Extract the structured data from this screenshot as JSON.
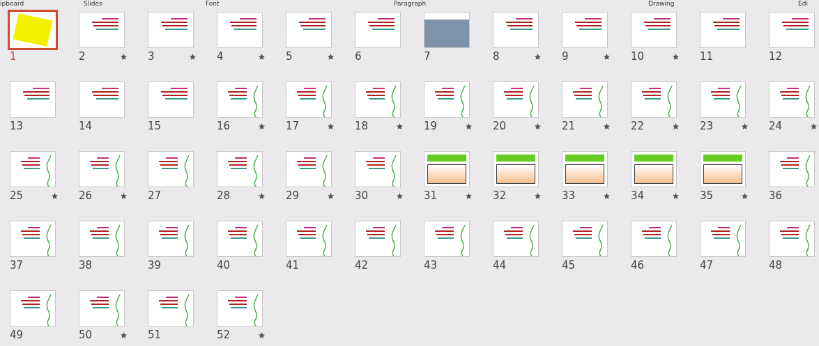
{
  "ribbon_groups": [
    "ipboard",
    "Slides",
    "Font",
    "Paragraph",
    "Drawing",
    "Edi"
  ],
  "slides": [
    {
      "number": "1",
      "kind": "title",
      "starred": false,
      "selected": true
    },
    {
      "number": "2",
      "kind": "text",
      "starred": true,
      "selected": false
    },
    {
      "number": "3",
      "kind": "text",
      "starred": true,
      "selected": false
    },
    {
      "number": "4",
      "kind": "text",
      "starred": true,
      "selected": false
    },
    {
      "number": "5",
      "kind": "text",
      "starred": true,
      "selected": false
    },
    {
      "number": "6",
      "kind": "text",
      "starred": false,
      "selected": false
    },
    {
      "number": "7",
      "kind": "table",
      "starred": false,
      "selected": false
    },
    {
      "number": "8",
      "kind": "text",
      "starred": true,
      "selected": false
    },
    {
      "number": "9",
      "kind": "text",
      "starred": true,
      "selected": false
    },
    {
      "number": "10",
      "kind": "text",
      "starred": true,
      "selected": false
    },
    {
      "number": "11",
      "kind": "text",
      "starred": false,
      "selected": false
    },
    {
      "number": "12",
      "kind": "text",
      "starred": false,
      "selected": false
    },
    {
      "number": "13",
      "kind": "text",
      "starred": false,
      "selected": false
    },
    {
      "number": "14",
      "kind": "text",
      "starred": false,
      "selected": false
    },
    {
      "number": "15",
      "kind": "text",
      "starred": false,
      "selected": false
    },
    {
      "number": "16",
      "kind": "pencil",
      "starred": true,
      "selected": false
    },
    {
      "number": "17",
      "kind": "pencil",
      "starred": true,
      "selected": false
    },
    {
      "number": "18",
      "kind": "pencil",
      "starred": true,
      "selected": false
    },
    {
      "number": "19",
      "kind": "pencil",
      "starred": true,
      "selected": false
    },
    {
      "number": "20",
      "kind": "pencil",
      "starred": true,
      "selected": false
    },
    {
      "number": "21",
      "kind": "pencil",
      "starred": true,
      "selected": false
    },
    {
      "number": "22",
      "kind": "pencil",
      "starred": true,
      "selected": false
    },
    {
      "number": "23",
      "kind": "pencil",
      "starred": true,
      "selected": false
    },
    {
      "number": "24",
      "kind": "pencil",
      "starred": true,
      "selected": false
    },
    {
      "number": "25",
      "kind": "pencil",
      "starred": true,
      "selected": false
    },
    {
      "number": "26",
      "kind": "pencil",
      "starred": true,
      "selected": false
    },
    {
      "number": "27",
      "kind": "pencil",
      "starred": false,
      "selected": false
    },
    {
      "number": "28",
      "kind": "pencil",
      "starred": true,
      "selected": false
    },
    {
      "number": "29",
      "kind": "pencil",
      "starred": true,
      "selected": false
    },
    {
      "number": "30",
      "kind": "pencil",
      "starred": true,
      "selected": false
    },
    {
      "number": "31",
      "kind": "banner",
      "starred": true,
      "selected": false
    },
    {
      "number": "32",
      "kind": "banner",
      "starred": true,
      "selected": false
    },
    {
      "number": "33",
      "kind": "banner",
      "starred": true,
      "selected": false
    },
    {
      "number": "34",
      "kind": "banner",
      "starred": true,
      "selected": false
    },
    {
      "number": "35",
      "kind": "banner",
      "starred": true,
      "selected": false
    },
    {
      "number": "36",
      "kind": "pencil",
      "starred": false,
      "selected": false
    },
    {
      "number": "37",
      "kind": "pencil",
      "starred": false,
      "selected": false
    },
    {
      "number": "38",
      "kind": "pencil",
      "starred": false,
      "selected": false
    },
    {
      "number": "39",
      "kind": "pencil",
      "starred": false,
      "selected": false
    },
    {
      "number": "40",
      "kind": "pencil",
      "starred": false,
      "selected": false
    },
    {
      "number": "41",
      "kind": "pencil",
      "starred": false,
      "selected": false
    },
    {
      "number": "42",
      "kind": "pencil",
      "starred": false,
      "selected": false
    },
    {
      "number": "43",
      "kind": "pencil",
      "starred": false,
      "selected": false
    },
    {
      "number": "44",
      "kind": "pencil",
      "starred": false,
      "selected": false
    },
    {
      "number": "45",
      "kind": "pencil",
      "starred": false,
      "selected": false
    },
    {
      "number": "46",
      "kind": "pencil",
      "starred": false,
      "selected": false
    },
    {
      "number": "47",
      "kind": "pencil",
      "starred": false,
      "selected": false
    },
    {
      "number": "48",
      "kind": "pencil",
      "starred": false,
      "selected": false
    },
    {
      "number": "49",
      "kind": "pencil",
      "starred": false,
      "selected": false
    },
    {
      "number": "50",
      "kind": "pencil",
      "starred": true,
      "selected": false
    },
    {
      "number": "51",
      "kind": "pencil",
      "starred": false,
      "selected": false
    },
    {
      "number": "52",
      "kind": "pencil",
      "starred": true,
      "selected": false
    }
  ]
}
